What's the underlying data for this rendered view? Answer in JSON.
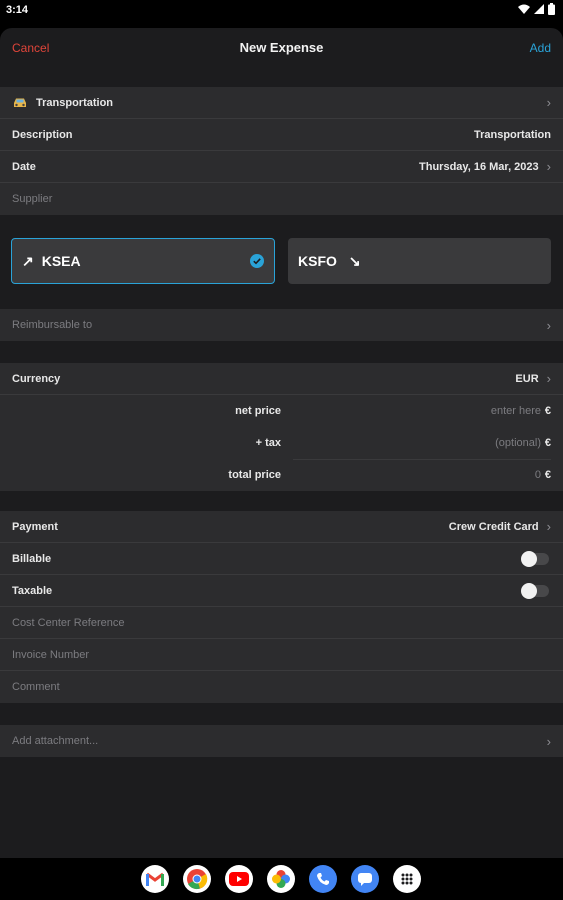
{
  "status": {
    "time": "3:14"
  },
  "nav": {
    "cancel": "Cancel",
    "title": "New Expense",
    "add": "Add"
  },
  "category": {
    "label": "Transportation"
  },
  "description": {
    "label": "Description",
    "value": "Transportation"
  },
  "date": {
    "label": "Date",
    "value": "Thursday, 16 Mar, 2023"
  },
  "supplier": {
    "placeholder": "Supplier"
  },
  "route": {
    "from": "KSEA",
    "to": "KSFO"
  },
  "reimbursable": {
    "placeholder": "Reimbursable to"
  },
  "currency": {
    "label": "Currency",
    "value": "EUR"
  },
  "prices": {
    "net": {
      "label": "net price",
      "placeholder": "enter here",
      "symbol": "€"
    },
    "tax": {
      "label": "+ tax",
      "placeholder": "(optional)",
      "symbol": "€"
    },
    "total": {
      "label": "total price",
      "value": "0",
      "symbol": "€"
    }
  },
  "payment": {
    "label": "Payment",
    "value": "Crew Credit Card"
  },
  "billable": {
    "label": "Billable",
    "on": false
  },
  "taxable": {
    "label": "Taxable",
    "on": false
  },
  "cost_center": {
    "placeholder": "Cost Center Reference"
  },
  "invoice": {
    "placeholder": "Invoice Number"
  },
  "comment": {
    "placeholder": "Comment"
  },
  "attachment": {
    "placeholder": "Add attachment..."
  },
  "dock": {
    "apps": [
      "gmail-icon",
      "chrome-icon",
      "youtube-icon",
      "photos-icon",
      "phone-icon",
      "messages-icon",
      "app-drawer-icon"
    ]
  },
  "colors": {
    "cancel": "#e0453a",
    "accent": "#2aa3d8",
    "background": "#1c1c1e",
    "cell": "#2c2c2e"
  }
}
